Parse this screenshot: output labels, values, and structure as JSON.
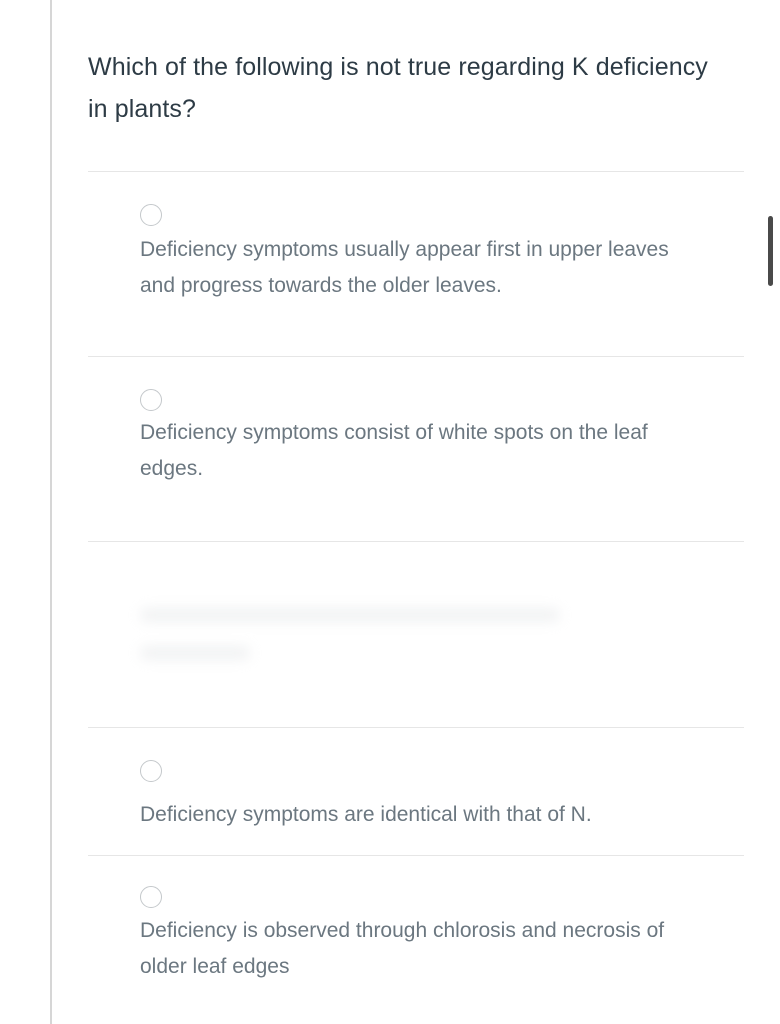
{
  "question": {
    "text": "Which of the following is not true regarding K deficiency in plants?"
  },
  "options": [
    {
      "text": "Deficiency symptoms usually appear first in upper leaves and progress towards the older leaves."
    },
    {
      "text": "Deficiency symptoms consist of white spots on the leaf edges."
    },
    {
      "text": "Deficiency symptoms are identical with that of N."
    },
    {
      "text": "Deficiency is observed through chlorosis and necrosis of older leaf edges"
    }
  ]
}
